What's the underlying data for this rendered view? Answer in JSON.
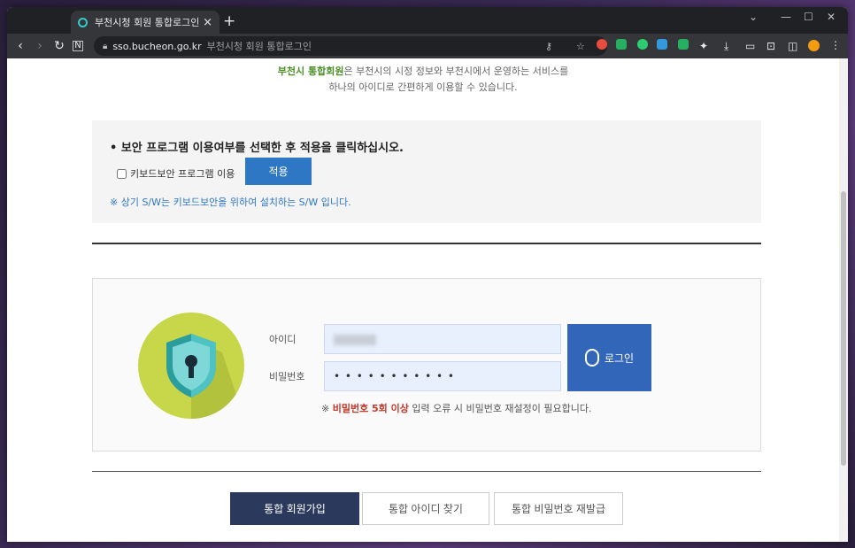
{
  "browser": {
    "tab_title": "부천시청 회원 통합로그인",
    "tab_close": "×",
    "new_tab": "+",
    "url_domain": "sso.bucheon.go.kr",
    "url_page_title": "부천시청 회원 통합로그인"
  },
  "intro": {
    "highlight": "부천시 통합회원",
    "line1_rest": "은 부천시의 시정 정보와 부천시에서 운영하는 서비스를",
    "line2": "하나의 아이디로 간편하게 이용할 수 있습니다."
  },
  "security": {
    "title": "보안 프로그램 이용여부를 선택한 후 적용을 클릭하십시오.",
    "checkbox_label": "키보드보안 프로그램 이용",
    "apply_label": "적용",
    "note": "※ 상기 S/W는 키보드보안을 위하여 설치하는 S/W 입니다."
  },
  "login": {
    "id_label": "아이디",
    "pw_label": "비밀번호",
    "pw_mask": "• • • • • • • • • • •",
    "login_label": "로그인",
    "warn_prefix": "※ ",
    "warn_red": "비밀번호 5회 이상",
    "warn_rest": " 입력 오류 시 비밀번호 재설정이 필요합니다."
  },
  "bottom": {
    "join_label": "통합 회원가입",
    "find_id_label": "통합 아이디 찾기",
    "reset_pw_label": "통합 비밀번호 재발급"
  },
  "colors": {
    "accent_green": "#4a8f26",
    "accent_blue": "#2e77c4",
    "login_blue": "#3266b8",
    "navy": "#2b3a5c",
    "warn_red": "#c0392b"
  }
}
